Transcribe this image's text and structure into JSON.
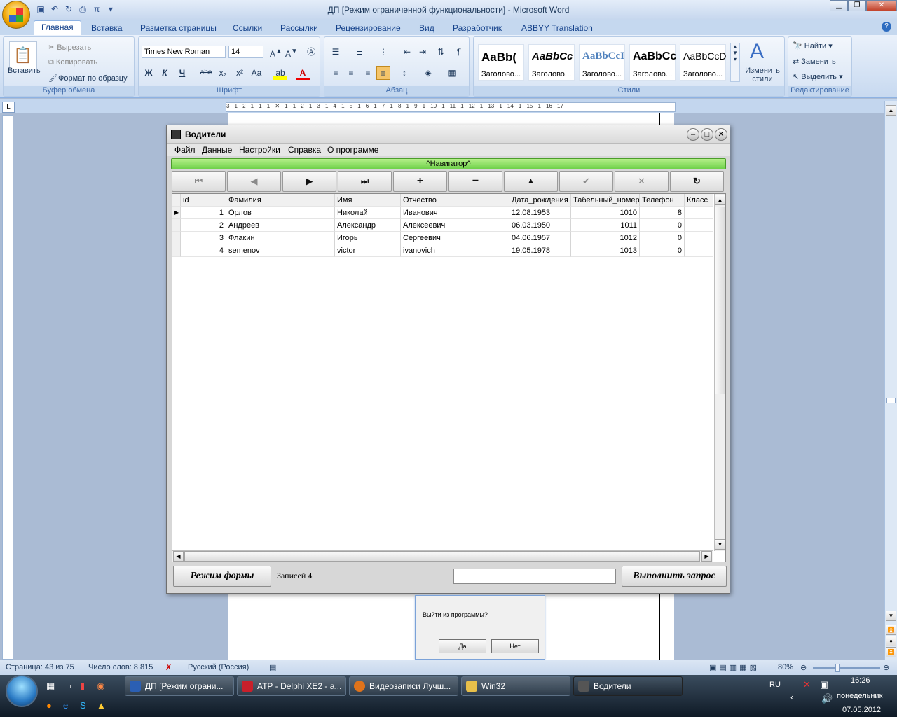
{
  "word": {
    "window_title": "ДП [Режим ограниченной функциональности] - Microsoft Word",
    "tabs": [
      "Главная",
      "Вставка",
      "Разметка страницы",
      "Ссылки",
      "Рассылки",
      "Рецензирование",
      "Вид",
      "Разработчик",
      "ABBYY Translation"
    ],
    "clipboard": {
      "paste": "Вставить",
      "cut": "Вырезать",
      "copy": "Копировать",
      "format_painter": "Формат по образцу",
      "label": "Буфер обмена"
    },
    "font": {
      "name": "Times New Roman",
      "size": "14",
      "label": "Шрифт",
      "bold": "Ж",
      "italic": "К",
      "underline": "Ч",
      "strike": "abe",
      "sub": "x₂",
      "sup": "x²",
      "case": "Aa"
    },
    "paragraph": {
      "label": "Абзац"
    },
    "styles": {
      "label": "Стили",
      "items": [
        {
          "sample": "AaBb(",
          "name": "Заголово..."
        },
        {
          "sample": "AaBbCc",
          "name": "Заголово..."
        },
        {
          "sample": "AaBbCcI",
          "name": "Заголово..."
        },
        {
          "sample": "AaBbCc",
          "name": "Заголово..."
        },
        {
          "sample": "AaBbCcD",
          "name": "Заголово..."
        }
      ],
      "change": "Изменить стили"
    },
    "editing": {
      "find": "Найти",
      "replace": "Заменить",
      "select": "Выделить",
      "label": "Редактирование"
    },
    "ruler_text": "3 · 1 · 2 · 1 · 1 · 1 · ✕ · 1 · 1 · 2 · 1 · 3 · 1 · 4 · 1 · 5 · 1 · 6 · 1 · 7 · 1 · 8 · 1 · 9 · 1 · 10 · 1 · 11 · 1 · 12 · 1 · 13 · 1 · 14 · 1 · 15 · 1 · 16 · 17 ·",
    "status": {
      "page": "Страница: 43 из 75",
      "words": "Число слов: 8 815",
      "lang": "Русский (Россия)",
      "zoom": "80%"
    }
  },
  "app": {
    "title": "Водители",
    "menu": [
      "Файл",
      "Данные",
      "Настройки",
      "Справка",
      "О программе"
    ],
    "navigator_label": "^Навигатор^",
    "nav_buttons": [
      {
        "glyph": "⏮",
        "enabled": false
      },
      {
        "glyph": "◀",
        "enabled": false
      },
      {
        "glyph": "▶",
        "enabled": true
      },
      {
        "glyph": "⏭",
        "enabled": true
      },
      {
        "glyph": "+",
        "enabled": true
      },
      {
        "glyph": "−",
        "enabled": true
      },
      {
        "glyph": "▲",
        "enabled": true
      },
      {
        "glyph": "✔",
        "enabled": false
      },
      {
        "glyph": "✕",
        "enabled": false
      },
      {
        "glyph": "↻",
        "enabled": true
      }
    ],
    "grid": {
      "columns": [
        "id",
        "Фамилия",
        "Имя",
        "Отчество",
        "Дата_рождения",
        "Табельный_номер",
        "Телефон",
        "Класс"
      ],
      "rows": [
        [
          "1",
          "Орлов",
          "Николай",
          "Иванович",
          "12.08.1953",
          "1010",
          "8",
          ""
        ],
        [
          "2",
          "Андреев",
          "Александр",
          "Алексеевич",
          "06.03.1950",
          "1011",
          "0",
          ""
        ],
        [
          "3",
          "Флакин",
          "Игорь",
          "Сергеевич",
          "04.06.1957",
          "1012",
          "0",
          ""
        ],
        [
          "4",
          "semenov",
          "victor",
          "ivanovich",
          "19.05.1978",
          "1013",
          "0",
          ""
        ]
      ]
    },
    "form_mode_button": "Режим формы",
    "records_label": "Записей 4",
    "query_input": "",
    "run_query_button": "Выполнить запрос"
  },
  "dialog": {
    "message": "Выйти из программы?",
    "yes": "Да",
    "no": "Нет"
  },
  "taskbar": {
    "buttons": [
      {
        "label": "ДП [Режим ограни...",
        "color": "#2b5fb3"
      },
      {
        "label": "АТР - Delphi XE2 - а...",
        "color": "#c8202b"
      },
      {
        "label": "Видеозаписи Лучш...",
        "color": "#e0731a"
      },
      {
        "label": "Win32",
        "color": "#e8c04a"
      },
      {
        "label": "Водители",
        "color": "#555555"
      }
    ],
    "lang": "RU",
    "time": "16:26",
    "day": "понедельник",
    "date": "07.05.2012"
  }
}
